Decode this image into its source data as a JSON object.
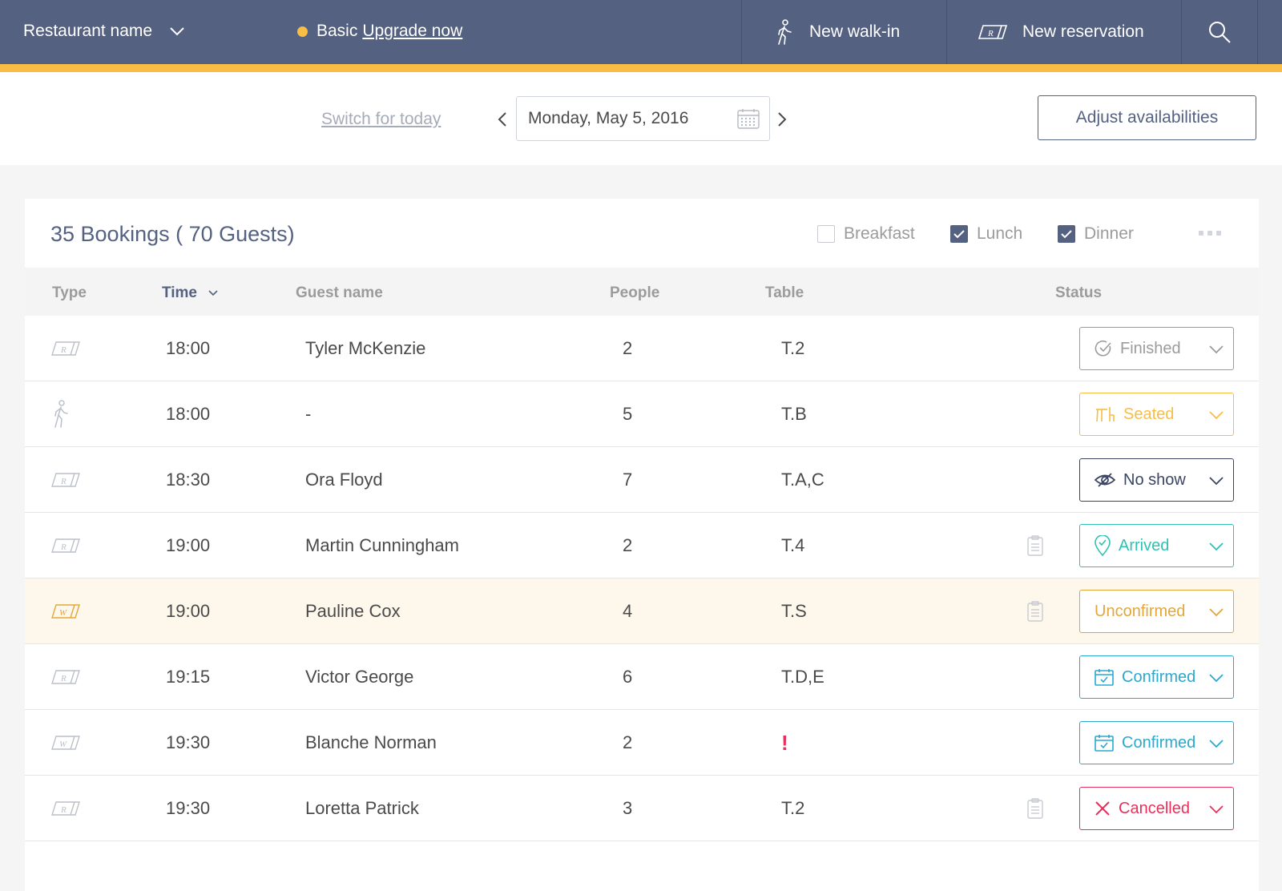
{
  "topbar": {
    "restaurant_name": "Restaurant name",
    "plan_label": "Basic",
    "upgrade_link": "Upgrade now",
    "walkin_label": "New walk-in",
    "reservation_label": "New reservation"
  },
  "datebar": {
    "switch_today": "Switch for today",
    "date_value": "Monday, May 5, 2016",
    "adjust_label": "Adjust availabilities"
  },
  "summary": {
    "title": "35 Bookings ( 70 Guests)"
  },
  "filters": {
    "breakfast": "Breakfast",
    "lunch": "Lunch",
    "dinner": "Dinner",
    "breakfast_checked": false,
    "lunch_checked": true,
    "dinner_checked": true
  },
  "columns": {
    "type": "Type",
    "time": "Time",
    "guest": "Guest name",
    "people": "People",
    "table": "Table",
    "status": "Status"
  },
  "colors": {
    "primary": "#546180",
    "accent": "#f7bd45",
    "finished": "#9b9b9b",
    "seated": "#f7bd45",
    "no_show": "#3b4563",
    "arrived": "#2fc2b4",
    "unconfirmed": "#e2a73a",
    "confirmed": "#2aa9cf",
    "cancelled": "#e8305b"
  },
  "bookings": [
    {
      "type_icon": "reservation-icon",
      "time": "18:00",
      "guest": "Tyler McKenzie",
      "people": "2",
      "table": "T.2",
      "note": false,
      "status": "Finished",
      "status_icon": "check-circle-icon",
      "status_key": "finished",
      "highlight": false
    },
    {
      "type_icon": "walkin-icon",
      "time": "18:00",
      "guest": "-",
      "people": "5",
      "table": "T.B",
      "note": false,
      "status": "Seated",
      "status_icon": "table-seat-icon",
      "status_key": "seated",
      "highlight": false
    },
    {
      "type_icon": "reservation-icon",
      "time": "18:30",
      "guest": "Ora Floyd",
      "people": "7",
      "table": "T.A,C",
      "note": false,
      "status": "No show",
      "status_icon": "eye-off-icon",
      "status_key": "no_show",
      "highlight": false
    },
    {
      "type_icon": "reservation-icon",
      "time": "19:00",
      "guest": "Martin Cunningham",
      "people": "2",
      "table": "T.4",
      "note": true,
      "status": "Arrived",
      "status_icon": "location-check-icon",
      "status_key": "arrived",
      "highlight": false
    },
    {
      "type_icon": "web-reservation-icon",
      "time": "19:00",
      "guest": "Pauline Cox",
      "people": "4",
      "table": "T.S",
      "note": true,
      "status": "Unconfirmed",
      "status_icon": "",
      "status_key": "unconfirmed",
      "highlight": true
    },
    {
      "type_icon": "reservation-icon",
      "time": "19:15",
      "guest": "Victor George",
      "people": "6",
      "table": "T.D,E",
      "note": false,
      "status": "Confirmed",
      "status_icon": "calendar-check-icon",
      "status_key": "confirmed",
      "highlight": false
    },
    {
      "type_icon": "web-reservation-icon",
      "time": "19:30",
      "guest": "Blanche Norman",
      "people": "2",
      "table": "!",
      "note": false,
      "status": "Confirmed",
      "status_icon": "calendar-check-icon",
      "status_key": "confirmed",
      "highlight": false
    },
    {
      "type_icon": "reservation-icon",
      "time": "19:30",
      "guest": "Loretta Patrick",
      "people": "3",
      "table": "T.2",
      "note": true,
      "status": "Cancelled",
      "status_icon": "close-icon",
      "status_key": "cancelled",
      "highlight": false
    }
  ]
}
